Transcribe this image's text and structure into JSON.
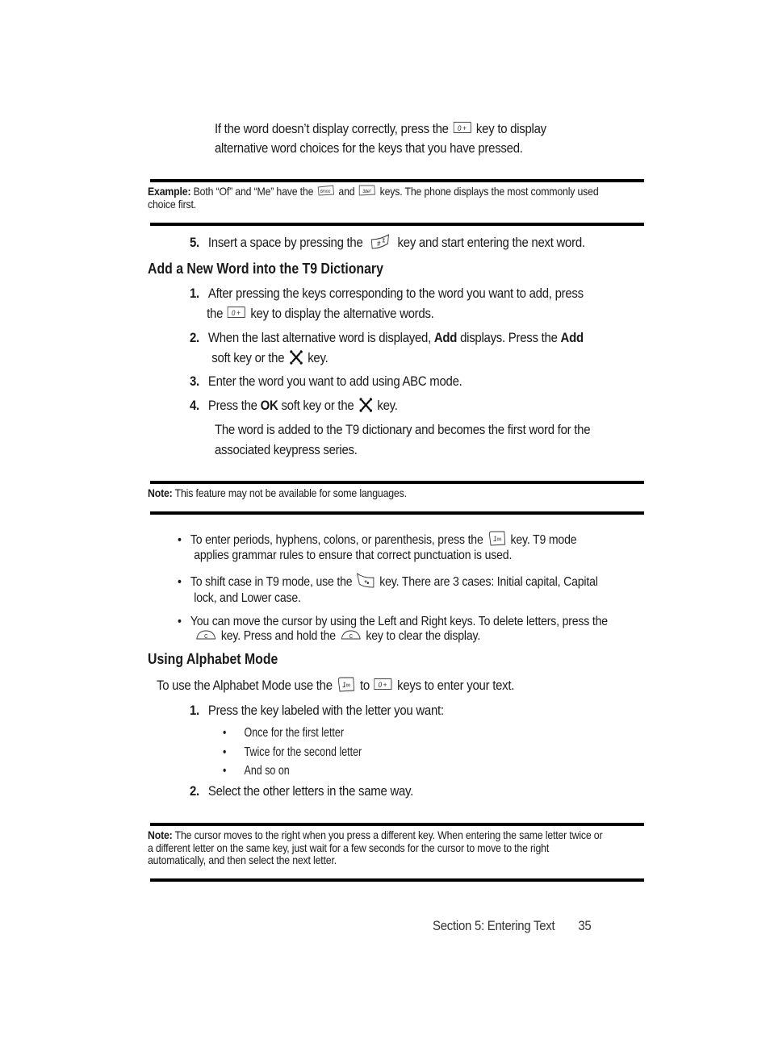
{
  "intro": {
    "line1_a": "If the word doesn’t display correctly, press the",
    "line1_b": "key to display",
    "line2": "alternative word choices for the keys that you have pressed."
  },
  "example_box": {
    "label": "Example:",
    "text_a": "Both “Of” and “Me” have the",
    "text_b": "and",
    "text_c": "keys. The phone displays the most commonly used",
    "text_d": "choice first."
  },
  "step5": {
    "number": "5.",
    "text_a": "Insert a space by pressing the",
    "text_b": "key and start entering the next word."
  },
  "section_add": {
    "heading": "Add a New Word into the T9 Dictionary",
    "steps": [
      {
        "number": "1.",
        "line1": "After pressing the keys corresponding to the word you want to add, press",
        "line2_a": "the",
        "line2_b": "key to display the alternative words."
      },
      {
        "number": "2.",
        "line1_a": "When the last alternative word is displayed,",
        "bold1": "Add",
        "line1_b": "displays. Press the",
        "bold2": "Add",
        "line2_a": "soft key or the",
        "line2_b": "key."
      },
      {
        "number": "3.",
        "line1": "Enter the word you want to add using ABC mode."
      },
      {
        "number": "4.",
        "line1_a": "Press the",
        "bold1": "OK",
        "line1_b": "soft key or the",
        "line1_c": "key."
      }
    ],
    "result_line1": "The word is added to the T9 dictionary and becomes the first word for the",
    "result_line2": "associated keypress series."
  },
  "note1": {
    "label": "Note:",
    "text": "This feature may not be available for some languages."
  },
  "bullets": [
    {
      "line1_a": "To enter periods, hyphens, colons, or parenthesis, press the",
      "line1_b": "key. T9 mode",
      "line2": "applies grammar rules to ensure that correct punctuation is used."
    },
    {
      "line1_a": "To shift case in T9 mode, use the",
      "line1_b": "key. There are 3 cases: Initial capital, Capital",
      "line2": "lock, and Lower case."
    },
    {
      "line1": "You can move the cursor by using the Left and Right keys. To delete letters, press the",
      "line2_a": "key. Press and hold the",
      "line2_b": "key to clear the display."
    }
  ],
  "section_alpha": {
    "heading": "Using Alphabet Mode",
    "intro_a": "To use the Alphabet Mode use the",
    "intro_b": "to",
    "intro_c": "keys to enter your text.",
    "step1": {
      "number": "1.",
      "text": "Press the key labeled with the letter you want:"
    },
    "sub_bullets": [
      "Once for the first letter",
      "Twice for the second letter",
      "And so on"
    ],
    "step2": {
      "number": "2.",
      "text": "Select the other letters in the same way."
    }
  },
  "note2": {
    "label": "Note:",
    "line1": "The cursor moves to the right when you press a different key. When entering the same letter twice or",
    "line2": "a different letter on the same key, just wait for a few seconds for the cursor to move to the right",
    "line3": "automatically, and then select the next letter."
  },
  "footer": {
    "section": "Section 5: Entering Text",
    "page": "35"
  },
  "keys": {
    "zero": "0 +",
    "six": "6mno",
    "three": "3def",
    "hash": "#",
    "one": "1∞",
    "star": "*",
    "clear": "C"
  }
}
